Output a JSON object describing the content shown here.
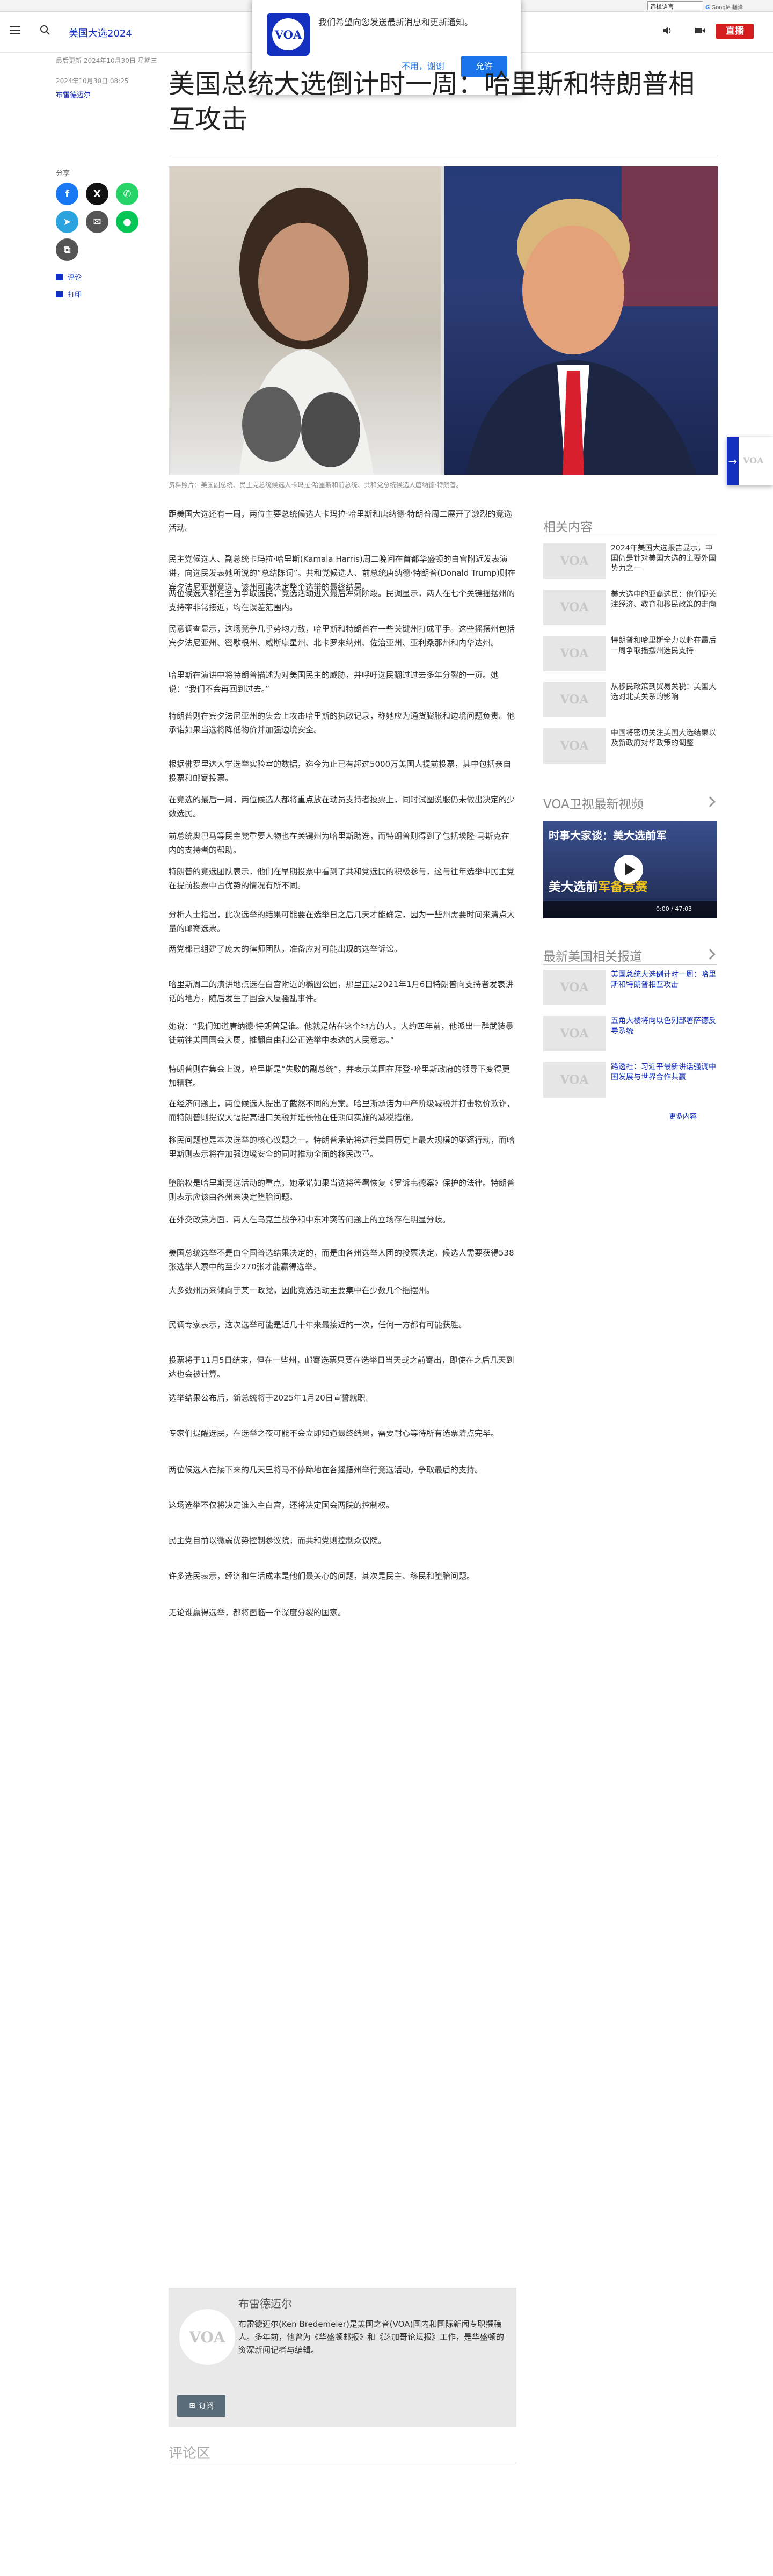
{
  "utility": {
    "language_select": "选择语言",
    "translate_by": "Google 翻译",
    "powered": "技术支持"
  },
  "header": {
    "section": "美国大选2024",
    "live": "直播"
  },
  "notification": {
    "text": "我们希望向您发送最新消息和更新通知。",
    "later": "不用，谢谢",
    "allow": "允许"
  },
  "article": {
    "meta_date": "最后更新 2024年10月30日 星期三",
    "meta_updated": "2024年10月30日 08:25",
    "author": "布雷德迈尔",
    "headline": "美国总统大选倒计时一周：哈里斯和特朗普相互攻击",
    "share_label": "分享",
    "comments_link": "评论",
    "print_link": "打印",
    "hero_caption": "资料照片：美国副总统、民主党总统候选人卡玛拉·哈里斯和前总统、共和党总统候选人唐纳德·特朗普。"
  },
  "paragraphs": [
    "距美国大选还有一周，两位主要总统候选人卡玛拉·哈里斯和唐纳德·特朗普周二展开了激烈的竞选活动。",
    "民主党候选人、副总统卡玛拉·哈里斯(Kamala Harris)周二晚间在首都华盛顿的白宫附近发表演讲，向选民发表她所说的“总结陈词”。共和党候选人、前总统唐纳德·特朗普(Donald Trump)则在宾夕法尼亚州竞选，该州可能决定整个选举的最终结果。",
    "两位候选人都在全力争取选民，竞选活动进入最后冲刺阶段。民调显示，两人在七个关键摇摆州的支持率非常接近，均在误差范围内。",
    "民意调查显示，这场竞争几乎势均力敌，哈里斯和特朗普在一些关键州打成平手。这些摇摆州包括宾夕法尼亚州、密歇根州、威斯康星州、北卡罗来纳州、佐治亚州、亚利桑那州和内华达州。",
    "哈里斯在演讲中将特朗普描述为对美国民主的威胁，并呼吁选民翻过过去多年分裂的一页。她说：“我们不会再回到过去。”",
    "特朗普则在宾夕法尼亚州的集会上攻击哈里斯的执政记录，称她应为通货膨胀和边境问题负责。他承诺如果当选将降低物价并加强边境安全。",
    "根据佛罗里达大学选举实验室的数据，迄今为止已有超过5000万美国人提前投票，其中包括亲自投票和邮寄投票。",
    "在竞选的最后一周，两位候选人都将重点放在动员支持者投票上，同时试图说服仍未做出决定的少数选民。",
    "前总统奥巴马等民主党重要人物也在关键州为哈里斯助选，而特朗普则得到了包括埃隆·马斯克在内的支持者的帮助。",
    "特朗普的竞选团队表示，他们在早期投票中看到了共和党选民的积极参与，这与往年选举中民主党在提前投票中占优势的情况有所不同。",
    "分析人士指出，此次选举的结果可能要在选举日之后几天才能确定，因为一些州需要时间来清点大量的邮寄选票。",
    "两党都已组建了庞大的律师团队，准备应对可能出现的选举诉讼。",
    "哈里斯周二的演讲地点选在白宫附近的椭圆公园，那里正是2021年1月6日特朗普向支持者发表讲话的地方，随后发生了国会大厦骚乱事件。",
    "她说：“我们知道唐纳德·特朗普是谁。他就是站在这个地方的人，大约四年前，他派出一群武装暴徒前往美国国会大厦，推翻自由和公正选举中表达的人民意志。”",
    "特朗普则在集会上说，哈里斯是“失败的副总统”，并表示美国在拜登-哈里斯政府的领导下变得更加糟糕。",
    "在经济问题上，两位候选人提出了截然不同的方案。哈里斯承诺为中产阶级减税并打击物价欺诈，而特朗普则提议大幅提高进口关税并延长他在任期间实施的减税措施。",
    "移民问题也是本次选举的核心议题之一。特朗普承诺将进行美国历史上最大规模的驱逐行动，而哈里斯则表示将在加强边境安全的同时推动全面的移民改革。",
    "堕胎权是哈里斯竞选活动的重点，她承诺如果当选将签署恢复《罗诉韦德案》保护的法律。特朗普则表示应该由各州来决定堕胎问题。",
    "在外交政策方面，两人在乌克兰战争和中东冲突等问题上的立场存在明显分歧。",
    "美国总统选举不是由全国普选结果决定的，而是由各州选举人团的投票决定。候选人需要获得538张选举人票中的至少270张才能赢得选举。",
    "大多数州历来倾向于某一政党，因此竞选活动主要集中在少数几个摇摆州。",
    "民调专家表示，这次选举可能是近几十年来最接近的一次，任何一方都有可能获胜。",
    "投票将于11月5日结束，但在一些州，邮寄选票只要在选举日当天或之前寄出，即使在之后几天到达也会被计算。",
    "选举结果公布后，新总统将于2025年1月20日宣誓就职。",
    "专家们提醒选民，在选举之夜可能不会立即知道最终结果，需要耐心等待所有选票清点完毕。",
    "两位候选人在接下来的几天里将马不停蹄地在各摇摆州举行竞选活动，争取最后的支持。",
    "这场选举不仅将决定谁入主白宫，还将决定国会两院的控制权。",
    "民主党目前以微弱优势控制参议院，而共和党则控制众议院。",
    "许多选民表示，经济和生活成本是他们最关心的问题，其次是民主、移民和堕胎问题。",
    "无论谁赢得选举，都将面临一个深度分裂的国家。"
  ],
  "author_box": {
    "name": "布雷德迈尔",
    "bio": "布雷德迈尔(Ken Bredemeier)是美国之音(VOA)国内和国际新闻专职撰稿人。多年前，他曾为《华盛顿邮报》和《芝加哥论坛报》工作，是华盛顿的资深新闻记者与编辑。",
    "subscribe": "订阅"
  },
  "comments": {
    "title": "评论区"
  },
  "sidebar": {
    "related_title": "相关内容",
    "related": [
      "2024年美国大选报告显示，中国仍是针对美国大选的主要外国势力之一",
      "美大选中的亚裔选民：他们更关注经济、教育和移民政策的走向",
      "特朗普和哈里斯全力以赴在最后一周争取摇摆州选民支持",
      "从移民政策到贸易关税：美国大选对北美关系的影响",
      "中国将密切关注美国大选结果以及新政府对华政策的调整"
    ],
    "video_title": "VOA卫视最新视频",
    "video_overlay_title": "时事大家谈：美大选前军",
    "video_band": "美大选前",
    "video_band_y": "军备竞赛",
    "video_time": "0:00 / 47:03",
    "latest_title": "最新美国相关报道",
    "latest": [
      "美国总统大选倒计时一周：哈里斯和特朗普相互攻击",
      "五角大楼将向以色列部署萨德反导系统",
      "路透社：习近平最新讲话强调中国发展与世界合作共赢"
    ],
    "more": "更多内容"
  },
  "edge_widget": {
    "label": "VOA"
  }
}
